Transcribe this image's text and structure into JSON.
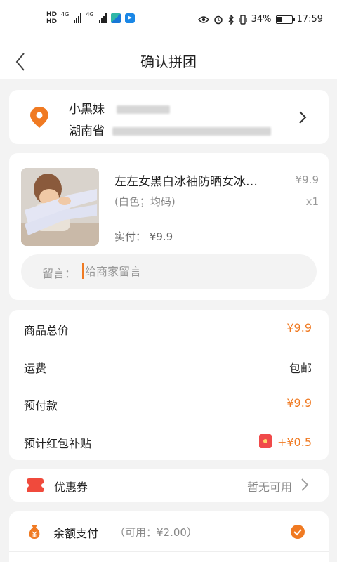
{
  "status_bar": {
    "hd_top": "HD",
    "hd_bottom": "HD",
    "net1": "4G",
    "net2": "4G",
    "battery_percent": "34%",
    "battery_level": 0.34,
    "time": "17:59"
  },
  "nav": {
    "title": "确认拼团"
  },
  "address": {
    "name": "小黑妹",
    "province": "湖南省"
  },
  "product": {
    "title": "左左女黑白冰袖防晒女冰…",
    "price": "¥9.9",
    "spec": "(白色；均码)",
    "quantity": "x1",
    "actual_label": "实付：",
    "actual_value": "¥9.9"
  },
  "remark": {
    "label": "留言：",
    "placeholder": "给商家留言",
    "value": ""
  },
  "summary": {
    "rows": [
      {
        "label": "商品总价",
        "value": "¥9.9"
      },
      {
        "label": "运费",
        "value": "包邮"
      },
      {
        "label": "预付款",
        "value": "¥9.9"
      },
      {
        "label": "预计红包补贴",
        "value": "+¥0.5"
      }
    ]
  },
  "coupon": {
    "label": "优惠券",
    "value": "暂无可用"
  },
  "balance": {
    "label": "余额支付",
    "available": "（可用：¥2.00）",
    "checked": true
  },
  "colors": {
    "accent": "#f07a22",
    "coupon_red": "#f04a3c",
    "background": "#f3f3f3"
  },
  "icons": [
    "back-arrow-icon",
    "location-pin-icon",
    "chevron-right-icon",
    "red-packet-icon",
    "coupon-ticket-icon",
    "money-bag-icon",
    "checkmark-icon"
  ]
}
